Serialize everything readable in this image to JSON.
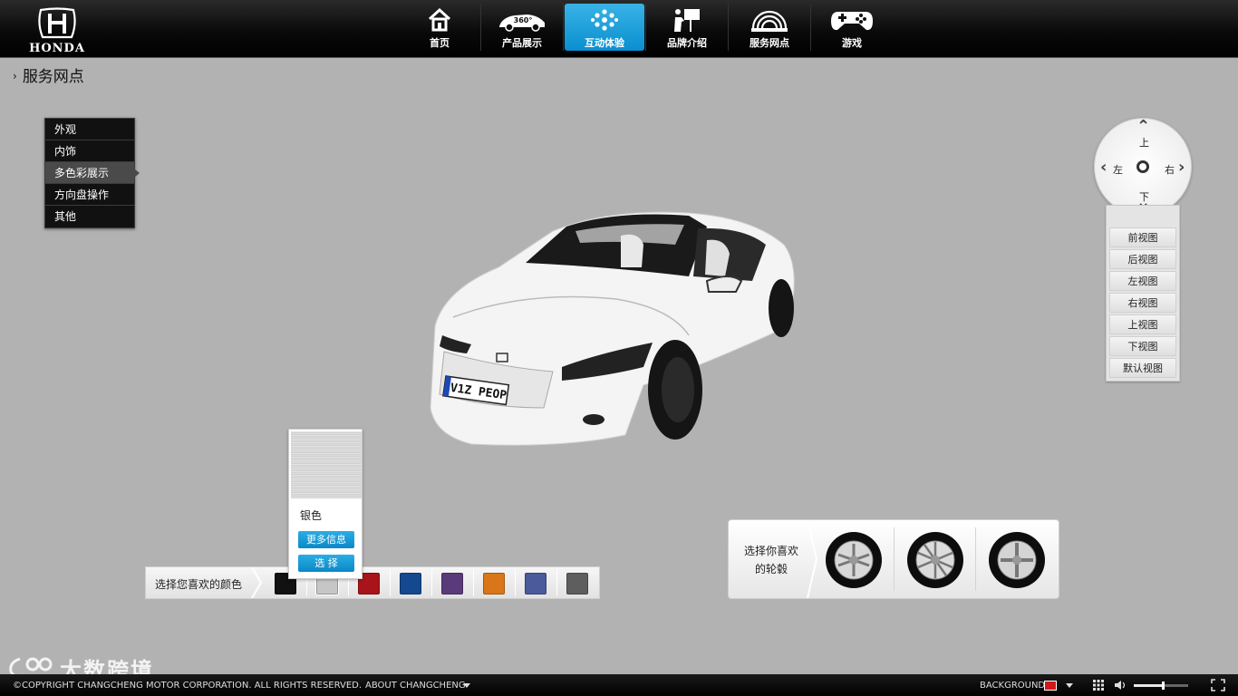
{
  "brand": {
    "wordmark": "HONDA"
  },
  "nav": [
    {
      "label": "首页",
      "icon": "home-icon",
      "active": false
    },
    {
      "label": "产品展示",
      "icon": "car-360-icon",
      "badge": "360°",
      "active": false
    },
    {
      "label": "互动体验",
      "icon": "interactive-dots-icon",
      "active": true
    },
    {
      "label": "品牌介绍",
      "icon": "presentation-icon",
      "active": false
    },
    {
      "label": "服务网点",
      "icon": "service-dome-icon",
      "active": false
    },
    {
      "label": "游戏",
      "icon": "gamepad-icon",
      "active": false
    }
  ],
  "page_title": "服务网点",
  "left_menu": [
    {
      "label": "外观",
      "active": false
    },
    {
      "label": "内饰",
      "active": false
    },
    {
      "label": "多色彩展示",
      "active": true
    },
    {
      "label": "方向盘操作",
      "active": false
    },
    {
      "label": "其他",
      "active": false
    }
  ],
  "car": {
    "plate": "V1Z PEOP"
  },
  "dpad": {
    "up": "上",
    "down": "下",
    "left": "左",
    "right": "右"
  },
  "views": [
    "前视图",
    "后视图",
    "左视图",
    "右视图",
    "上视图",
    "下视图",
    "默认视图"
  ],
  "color_popup": {
    "name": "银色",
    "more_info": "更多信息",
    "select": "选 择"
  },
  "color_bar": {
    "label": "选择您喜欢的颜色",
    "swatches": [
      "#111111",
      "#c6c6c6",
      "#a8141a",
      "#14488f",
      "#5a3a7a",
      "#d9761a",
      "#4a5a9a",
      "#5e5e5e"
    ],
    "selected_index": 1
  },
  "wheel_bar": {
    "label_line1": "选择你喜欢",
    "label_line2": "的轮毂",
    "wheels": [
      "wheel-1",
      "wheel-2",
      "wheel-3"
    ]
  },
  "watermark": {
    "text": "大数跨境"
  },
  "footer": {
    "copyright": "©COPYRIGHT CHANGCHENG MOTOR CORPORATION. ALL RIGHTS RESERVED.",
    "about": "ABOUT CHANGCHENG",
    "background": "BACKGROUND",
    "background_color": "#d01818",
    "volume_fraction": 0.53
  }
}
